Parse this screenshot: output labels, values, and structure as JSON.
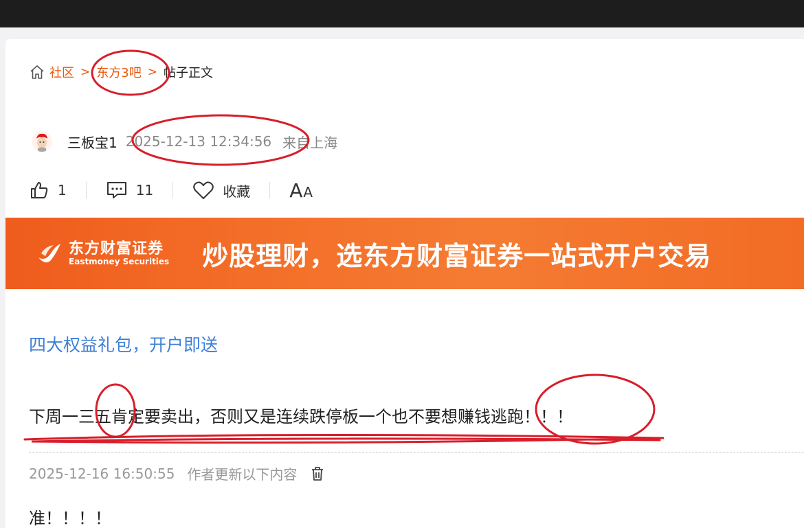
{
  "breadcrumb": {
    "home_icon": "home-icon",
    "community": "社区",
    "forum": "东方3吧",
    "current": "帖子正文",
    "separator": ">"
  },
  "post": {
    "author": "三板宝1",
    "time": "2025-12-13 12:34:56",
    "location": "来自上海",
    "likes": "1",
    "comments": "11",
    "favorite_label": "收藏",
    "font_toggle_big": "A",
    "font_toggle_small": "A",
    "body": "下周一三五肯定要卖出，否则又是连续跌停板一个也不要想赚钱逃跑！！！"
  },
  "banner": {
    "brand_cn": "东方财富证券",
    "brand_en": "Eastmoney Securities",
    "slogan": "炒股理财，选东方财富证券一站式开户交易"
  },
  "promo_link": "四大权益礼包，开户即送",
  "update": {
    "time": "2025-12-16 16:50:55",
    "label": "作者更新以下内容",
    "text": "准！！！！"
  },
  "colors": {
    "accent": "#ea5504",
    "link": "#3e7fd8",
    "annotation": "#d81e2a",
    "banner": "#f36e28"
  }
}
